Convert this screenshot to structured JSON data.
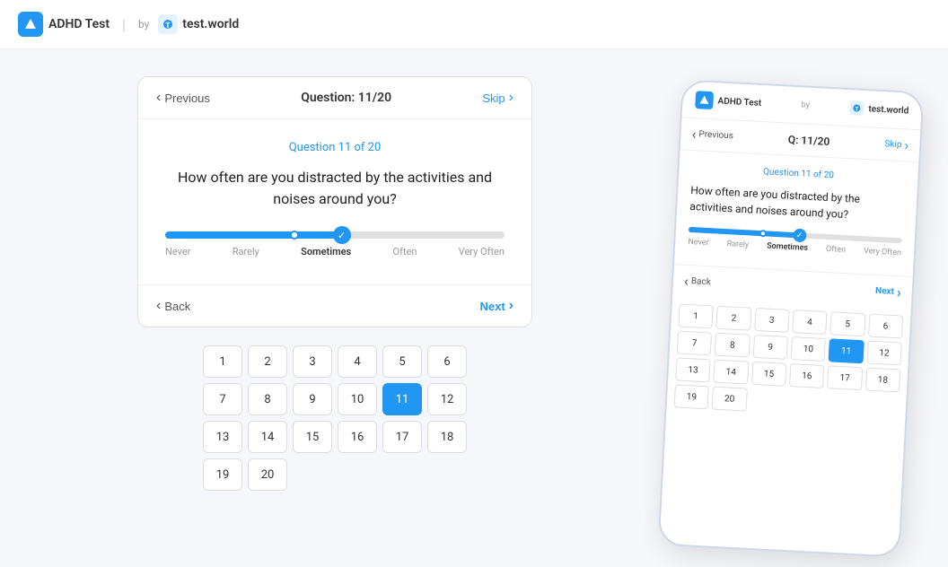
{
  "header": {
    "logo_icon": "A",
    "app_name": "ADHD Test",
    "by_label": "by",
    "brand_logo": "T",
    "brand_name": "test.world"
  },
  "quiz": {
    "prev_label": "Previous",
    "question_label": "Question: 11/20",
    "skip_label": "Skip",
    "question_progress": "Question 11 of 20",
    "question_text": "How often are you distracted by the activities and noises around you?",
    "slider_labels": [
      "Never",
      "Rarely",
      "Sometimes",
      "Often",
      "Very Often"
    ],
    "slider_active_label": "Sometimes",
    "back_label": "Back",
    "next_label": "Next"
  },
  "number_grid": {
    "numbers": [
      1,
      2,
      3,
      4,
      5,
      6,
      7,
      8,
      9,
      10,
      11,
      12,
      13,
      14,
      15,
      16,
      17,
      18,
      19,
      20
    ],
    "active_number": 11
  },
  "phone": {
    "app_name": "ADHD Test",
    "by_label": "by",
    "brand_name": "test.world",
    "prev_label": "Previous",
    "question_label": "Q: 11/20",
    "skip_label": "Skip",
    "question_progress": "Question 11 of 20",
    "question_text": "How often are you distracted by the activities and noises around you?",
    "slider_labels": [
      "Never",
      "Rarely",
      "Sometimes",
      "Often",
      "Very Often"
    ],
    "slider_active_label": "Sometimes",
    "back_label": "Back",
    "next_label": "Next",
    "numbers": [
      1,
      2,
      3,
      4,
      5,
      6,
      7,
      8,
      9,
      10,
      11,
      12,
      13,
      14,
      15,
      16,
      17,
      18,
      19,
      20
    ],
    "active_number": 11
  }
}
